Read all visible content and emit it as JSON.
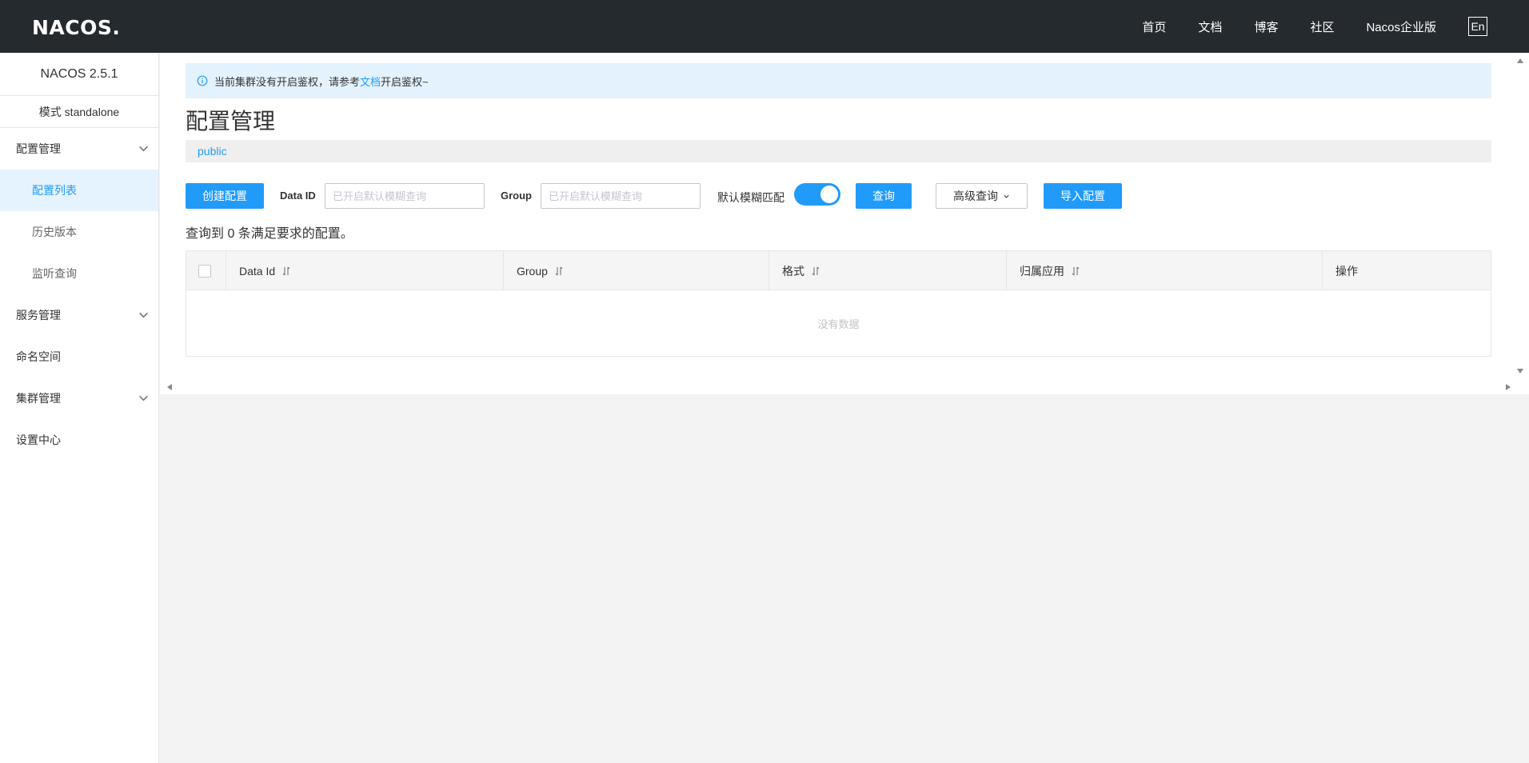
{
  "header": {
    "logo": "NACOS.",
    "nav": [
      "首页",
      "文档",
      "博客",
      "社区",
      "Nacos企业版"
    ],
    "lang": "En"
  },
  "sidebar": {
    "version": "NACOS 2.5.1",
    "mode": "模式 standalone",
    "config_group": "配置管理",
    "config_items": [
      "配置列表",
      "历史版本",
      "监听查询"
    ],
    "service_group": "服务管理",
    "namespace": "命名空间",
    "cluster_group": "集群管理",
    "settings": "设置中心"
  },
  "notice": {
    "text_before": "当前集群没有开启鉴权，请参考",
    "link": "文档",
    "text_after": "开启鉴权~"
  },
  "page_title": "配置管理",
  "namespace_tab": "public",
  "toolbar": {
    "create_button": "创建配置",
    "data_id_label": "Data ID",
    "data_id_placeholder": "已开启默认模糊查询",
    "group_label": "Group",
    "group_placeholder": "已开启默认模糊查询",
    "fuzzy_label": "默认模糊匹配",
    "fuzzy_enabled": true,
    "query_button": "查询",
    "advanced_button": "高级查询",
    "import_button": "导入配置"
  },
  "result_text": "查询到 0 条满足要求的配置。",
  "table": {
    "columns": [
      "Data Id",
      "Group",
      "格式",
      "归属应用",
      "操作"
    ],
    "empty_text": "没有数据"
  },
  "colors": {
    "header_bg": "#252a2f",
    "primary": "#209bfa",
    "active_bg": "#e5f3ff",
    "notice_bg": "#e3f2fd"
  }
}
